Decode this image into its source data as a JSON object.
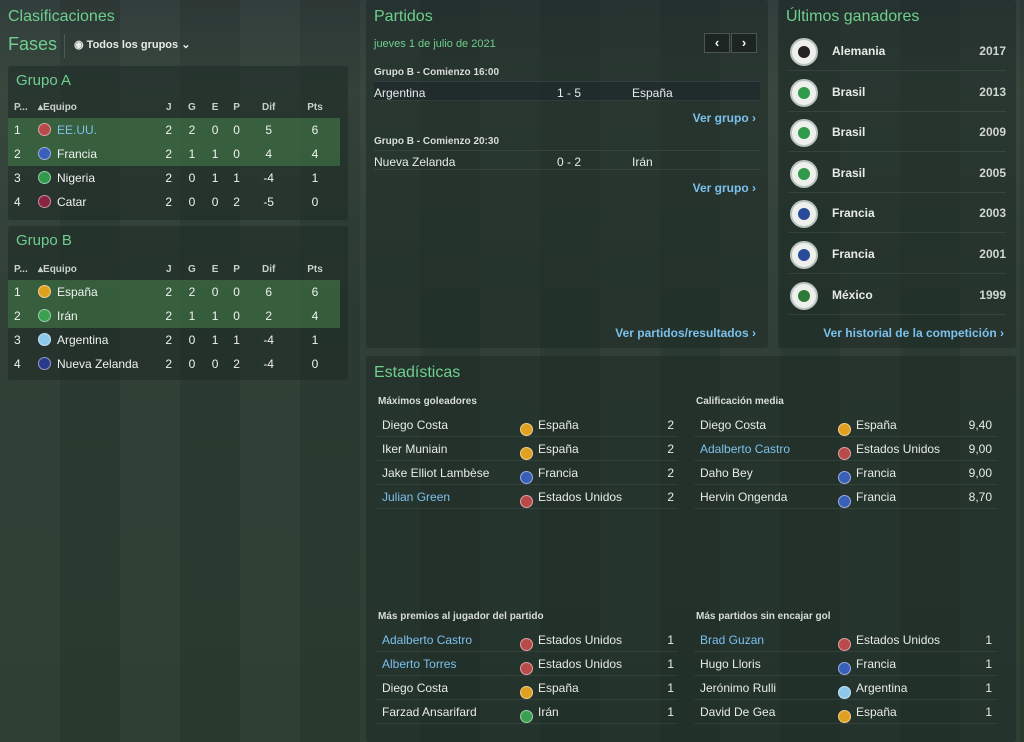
{
  "header": {
    "title": "Clasificaciones",
    "phase": "Fases",
    "filter": "Todos los grupos"
  },
  "groups": [
    {
      "title": "Grupo A",
      "cols": [
        "P...",
        "Equipo",
        "J",
        "G",
        "E",
        "P",
        "Dif",
        "Pts"
      ],
      "rows": [
        {
          "pos": "1",
          "team": "EE.UU.",
          "link": true,
          "flag": "#b84a4a",
          "J": "2",
          "G": "2",
          "E": "0",
          "P": "0",
          "Dif": "5",
          "Pts": "6",
          "q": true
        },
        {
          "pos": "2",
          "team": "Francia",
          "flag": "#3a5fb8",
          "J": "2",
          "G": "1",
          "E": "1",
          "P": "0",
          "Dif": "4",
          "Pts": "4",
          "q": true
        },
        {
          "pos": "3",
          "team": "Nigeria",
          "flag": "#2f9a4a",
          "J": "2",
          "G": "0",
          "E": "1",
          "P": "1",
          "Dif": "-4",
          "Pts": "1"
        },
        {
          "pos": "4",
          "team": "Catar",
          "flag": "#8a2440",
          "J": "2",
          "G": "0",
          "E": "0",
          "P": "2",
          "Dif": "-5",
          "Pts": "0"
        }
      ]
    },
    {
      "title": "Grupo B",
      "cols": [
        "P...",
        "Equipo",
        "J",
        "G",
        "E",
        "P",
        "Dif",
        "Pts"
      ],
      "rows": [
        {
          "pos": "1",
          "team": "España",
          "flag": "#e0a020",
          "J": "2",
          "G": "2",
          "E": "0",
          "P": "0",
          "Dif": "6",
          "Pts": "6",
          "q": true
        },
        {
          "pos": "2",
          "team": "Irán",
          "flag": "#3aa050",
          "J": "2",
          "G": "1",
          "E": "1",
          "P": "0",
          "Dif": "2",
          "Pts": "4",
          "q": true
        },
        {
          "pos": "3",
          "team": "Argentina",
          "flag": "#8ec8ec",
          "J": "2",
          "G": "0",
          "E": "1",
          "P": "1",
          "Dif": "-4",
          "Pts": "1"
        },
        {
          "pos": "4",
          "team": "Nueva Zelanda",
          "flag": "#2a3a8a",
          "J": "2",
          "G": "0",
          "E": "0",
          "P": "2",
          "Dif": "-4",
          "Pts": "0"
        }
      ]
    }
  ],
  "matches": {
    "title": "Partidos",
    "date": "jueves 1 de julio de 2021",
    "items": [
      {
        "group": "Grupo B - Comienzo 16:00",
        "home": "Argentina",
        "score": "1 - 5",
        "away": "España",
        "link": "Ver grupo"
      },
      {
        "group": "Grupo B - Comienzo 20:30",
        "home": "Nueva Zelanda",
        "score": "0 - 2",
        "away": "Irán",
        "link": "Ver grupo"
      }
    ],
    "all_link": "Ver partidos/resultados"
  },
  "winners": {
    "title": "Últimos ganadores",
    "items": [
      {
        "team": "Alemania",
        "year": "2017",
        "color": "#222222"
      },
      {
        "team": "Brasil",
        "year": "2013",
        "color": "#2f9a4a"
      },
      {
        "team": "Brasil",
        "year": "2009",
        "color": "#2f9a4a"
      },
      {
        "team": "Brasil",
        "year": "2005",
        "color": "#2f9a4a"
      },
      {
        "team": "Francia",
        "year": "2003",
        "color": "#2a4a9a"
      },
      {
        "team": "Francia",
        "year": "2001",
        "color": "#2a4a9a"
      },
      {
        "team": "México",
        "year": "1999",
        "color": "#2f7a3a"
      }
    ],
    "history_link": "Ver historial de la competición"
  },
  "stats": {
    "title": "Estadísticas",
    "blocks": [
      {
        "title": "Máximos goleadores",
        "rows": [
          {
            "name": "Diego Costa",
            "nation": "España",
            "flag": "#e0a020",
            "value": "2"
          },
          {
            "name": "Iker Muniain",
            "nation": "España",
            "flag": "#e0a020",
            "value": "2"
          },
          {
            "name": "Jake Elliot Lambèse",
            "nation": "Francia",
            "flag": "#3a5fb8",
            "value": "2"
          },
          {
            "name": "Julian Green",
            "nation": "Estados Unidos",
            "flag": "#b84a4a",
            "value": "2",
            "link": true
          }
        ]
      },
      {
        "title": "Calificación media",
        "rows": [
          {
            "name": "Diego Costa",
            "nation": "España",
            "flag": "#e0a020",
            "value": "9,40"
          },
          {
            "name": "Adalberto Castro",
            "nation": "Estados Unidos",
            "flag": "#b84a4a",
            "value": "9,00",
            "link": true
          },
          {
            "name": "Daho Bey",
            "nation": "Francia",
            "flag": "#3a5fb8",
            "value": "9,00"
          },
          {
            "name": "Hervin Ongenda",
            "nation": "Francia",
            "flag": "#3a5fb8",
            "value": "8,70"
          }
        ]
      },
      {
        "title": "Más premios al jugador del partido",
        "rows": [
          {
            "name": "Adalberto Castro",
            "nation": "Estados Unidos",
            "flag": "#b84a4a",
            "value": "1",
            "link": true
          },
          {
            "name": "Alberto Torres",
            "nation": "Estados Unidos",
            "flag": "#b84a4a",
            "value": "1",
            "link": true
          },
          {
            "name": "Diego Costa",
            "nation": "España",
            "flag": "#e0a020",
            "value": "1"
          },
          {
            "name": "Farzad Ansarifard",
            "nation": "Irán",
            "flag": "#3aa050",
            "value": "1"
          }
        ]
      },
      {
        "title": "Más partidos sin encajar gol",
        "rows": [
          {
            "name": "Brad Guzan",
            "nation": "Estados Unidos",
            "flag": "#b84a4a",
            "value": "1",
            "link": true
          },
          {
            "name": "Hugo Lloris",
            "nation": "Francia",
            "flag": "#3a5fb8",
            "value": "1"
          },
          {
            "name": "Jerónimo Rulli",
            "nation": "Argentina",
            "flag": "#8ec8ec",
            "value": "1"
          },
          {
            "name": "David De Gea",
            "nation": "España",
            "flag": "#e0a020",
            "value": "1"
          }
        ]
      }
    ]
  }
}
